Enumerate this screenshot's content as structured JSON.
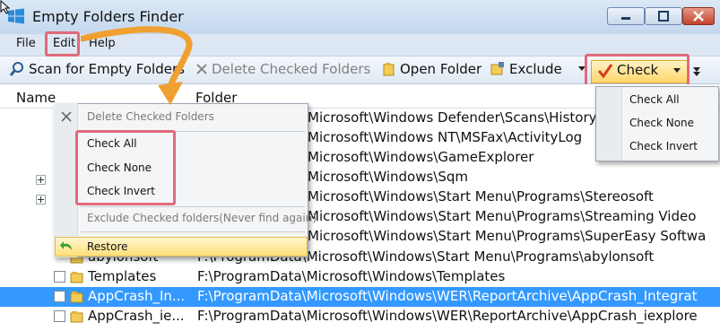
{
  "window": {
    "title": "Empty Folders Finder"
  },
  "menu": {
    "file": "File",
    "edit": "Edit",
    "help": "Help"
  },
  "toolbar": {
    "scan": "Scan for Empty Folders",
    "delete": "Delete Checked Folders",
    "open": "Open Folder",
    "exclude": "Exclude",
    "check": "Check"
  },
  "columns": {
    "name": "Name",
    "folder": "Folder"
  },
  "rows": [
    {
      "name": "",
      "folder": "Microsoft\\Windows Defender\\Scans\\History"
    },
    {
      "name": "",
      "folder": "Microsoft\\Windows NT\\MSFax\\ActivityLog"
    },
    {
      "name": "",
      "folder": "Microsoft\\Windows\\GameExplorer"
    },
    {
      "name": "",
      "folder": "Microsoft\\Windows\\Sqm"
    },
    {
      "name": "",
      "folder": "Microsoft\\Windows\\Start Menu\\Programs\\Stereosoft"
    },
    {
      "name": "",
      "folder": "Microsoft\\Windows\\Start Menu\\Programs\\Streaming Video"
    },
    {
      "name": "",
      "folder": "Microsoft\\Windows\\Start Menu\\Programs\\SuperEasy Softwa"
    },
    {
      "name": "abylonsoft",
      "folder": "F:\\ProgramData\\Microsoft\\Windows\\Start Menu\\Programs\\abylonsoft"
    },
    {
      "name": "Templates",
      "folder": "F:\\ProgramData\\Microsoft\\Windows\\Templates"
    },
    {
      "name": "AppCrash_In...",
      "folder": "F:\\ProgramData\\Microsoft\\Windows\\WER\\ReportArchive\\AppCrash_Integrat"
    },
    {
      "name": "AppCrash_ie...",
      "folder": "F:\\ProgramData\\Microsoft\\Windows\\WER\\ReportArchive\\AppCrash_iexplore"
    }
  ],
  "edit_menu": {
    "delete": "Delete Checked Folders",
    "check_all": "Check All",
    "check_none": "Check None",
    "check_invert": "Check Invert",
    "exclude": "Exclude Checked folders(Never find again)",
    "restore": "Restore"
  },
  "check_menu": {
    "check_all": "Check All",
    "check_none": "Check None",
    "check_invert": "Check Invert"
  },
  "colors": {
    "accent": "#e06a7a",
    "arrow": "#f0a030",
    "selection": "#3399ff"
  }
}
